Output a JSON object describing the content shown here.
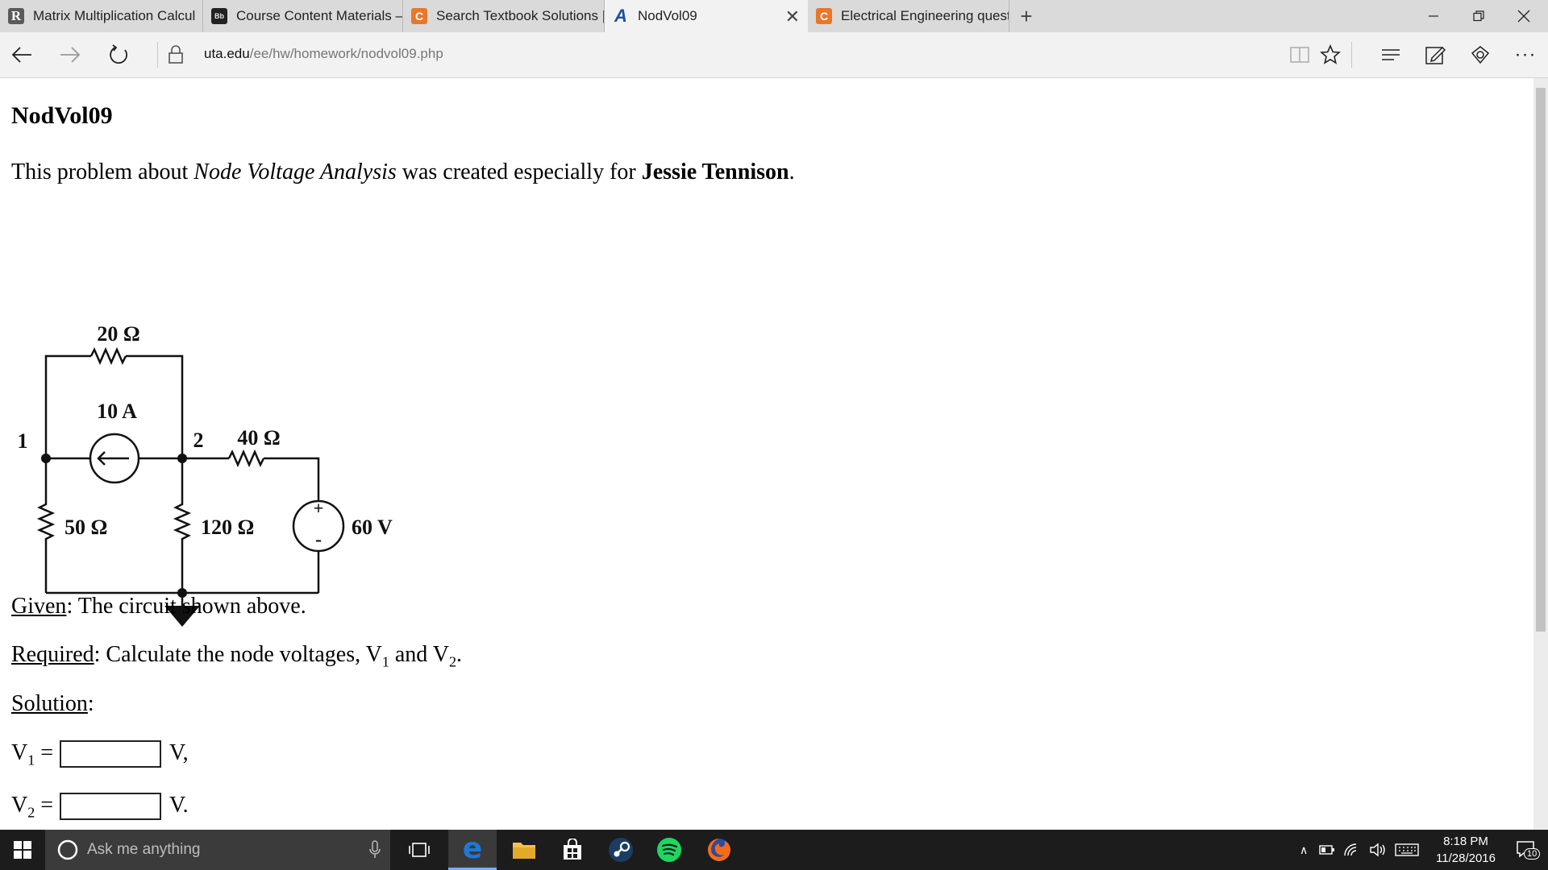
{
  "browser": {
    "tabs": [
      {
        "title": "Matrix Multiplication Calcul",
        "icon": "r-favicon"
      },
      {
        "title": "Course Content Materials –",
        "icon": "blackboard-favicon"
      },
      {
        "title": "Search Textbook Solutions |",
        "icon": "chegg-favicon"
      },
      {
        "title": "NodVol09",
        "icon": "a-favicon",
        "active": true
      },
      {
        "title": "Electrical Engineering quest",
        "icon": "chegg-favicon"
      }
    ],
    "favicon_letters": {
      "r": "R",
      "bb": "Bb",
      "c": "C",
      "a": "A"
    },
    "url_host": "uta.edu",
    "url_path": "/ee/hw/homework/nodvol09.php"
  },
  "page": {
    "title": "NodVol09",
    "intro_prefix": "This problem about ",
    "intro_topic": "Node Voltage Analysis",
    "intro_mid": " was created especially for ",
    "intro_name": "Jessie Tennison",
    "intro_end": ".",
    "given_label": "Given",
    "given_text": ": The circuit shown above.",
    "required_label": "Required",
    "required_text_a": ": Calculate the node voltages, V",
    "required_sub1": "1",
    "required_text_b": " and V",
    "required_sub2": "2",
    "required_text_c": ".",
    "solution_label": "Solution",
    "solution_colon": ":",
    "v1_letter": "V",
    "v1_sub": "1",
    "v1_eq": " =",
    "v1_value": "",
    "v1_unit": "V,",
    "v2_letter": "V",
    "v2_sub": "2",
    "v2_eq": " =",
    "v2_value": "",
    "v2_unit": "V."
  },
  "circuit": {
    "r_top": "20 Ω",
    "current_source": "10 A",
    "node1": "1",
    "node2": "2",
    "r_mid": "40 Ω",
    "r_left": "50 Ω",
    "r_center": "120 Ω",
    "voltage_source": "60 V",
    "plus": "+",
    "minus": "-"
  },
  "taskbar": {
    "search_placeholder": "Ask me anything",
    "time": "8:18 PM",
    "date": "11/28/2016",
    "notification_count": "10"
  },
  "colors": {
    "spotify": "#1ed760",
    "edge_blue": "#1e78d7",
    "firefox_orange": "#f26c1c",
    "chegg_orange": "#e8772a"
  }
}
